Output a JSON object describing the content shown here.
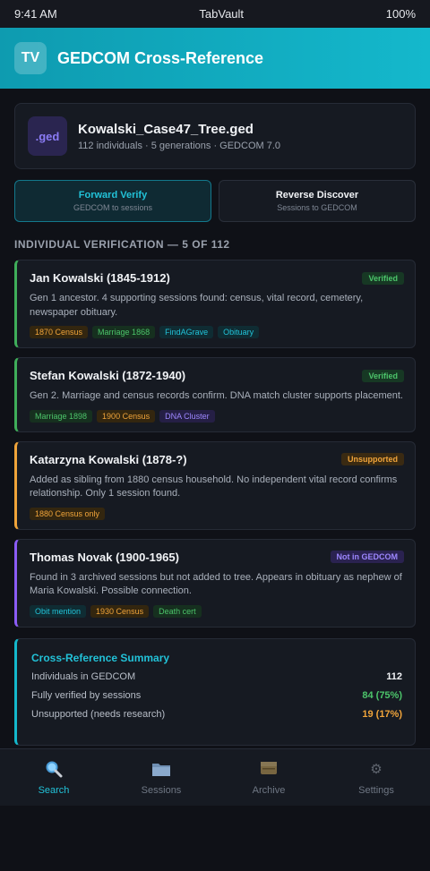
{
  "status_bar": {
    "time": "9:41 AM",
    "carrier": "TabVault",
    "battery": "100%"
  },
  "header": {
    "logo": "TV",
    "title": "GEDCOM Cross-Reference"
  },
  "file": {
    "icon_label": ".ged",
    "name": "Kowalski_Case47_Tree.ged",
    "meta": "112 individuals · 5 generations · GEDCOM 7.0"
  },
  "modes": [
    {
      "title": "Forward Verify",
      "sub": "GEDCOM to sessions",
      "active": true
    },
    {
      "title": "Reverse Discover",
      "sub": "Sessions to GEDCOM",
      "active": false
    }
  ],
  "section_title": "INDIVIDUAL VERIFICATION — 5 OF 112",
  "individuals": [
    {
      "name": "Jan Kowalski (1845-1912)",
      "badge": "Verified",
      "desc": "Gen 1 ancestor. 4 supporting sessions found: census, vital record, cemetery, newspaper obituary.",
      "tags": [
        "1870 Census",
        "Marriage 1868",
        "FindAGrave",
        "Obituary"
      ]
    },
    {
      "name": "Stefan Kowalski (1872-1940)",
      "badge": "Verified",
      "desc": "Gen 2. Marriage and census records confirm. DNA match cluster supports placement.",
      "tags": [
        "Marriage 1898",
        "1900 Census",
        "DNA Cluster"
      ]
    },
    {
      "name": "Katarzyna Kowalski (1878-?)",
      "badge": "Unsupported",
      "desc": "Added as sibling from 1880 census household. No independent vital record confirms relationship. Only 1 session found.",
      "tags": [
        "1880 Census only"
      ]
    },
    {
      "name": "Thomas Novak (1900-1965)",
      "badge": "Not in GEDCOM",
      "desc": "Found in 3 archived sessions but not added to tree. Appears in obituary as nephew of Maria Kowalski. Possible connection.",
      "tags": [
        "Obit mention",
        "1930 Census",
        "Death cert"
      ]
    }
  ],
  "summary": {
    "title": "Cross-Reference Summary",
    "rows": [
      {
        "label": "Individuals in GEDCOM",
        "value": "112"
      },
      {
        "label": "Fully verified by sessions",
        "value": "84 (75%)"
      },
      {
        "label": "Unsupported (needs research)",
        "value": "19 (17%)"
      }
    ]
  },
  "tabs": [
    {
      "label": "Search",
      "icon": "search-icon"
    },
    {
      "label": "Sessions",
      "icon": "folder-icon"
    },
    {
      "label": "Archive",
      "icon": "archive-icon"
    },
    {
      "label": "Settings",
      "icon": "gear-icon"
    }
  ],
  "colors": {
    "accent": "#14b8cc",
    "verified": "#4cc46a",
    "unsupported": "#f0a43a",
    "not_in_gedcom": "#9d87ff",
    "background": "#0f1117"
  }
}
